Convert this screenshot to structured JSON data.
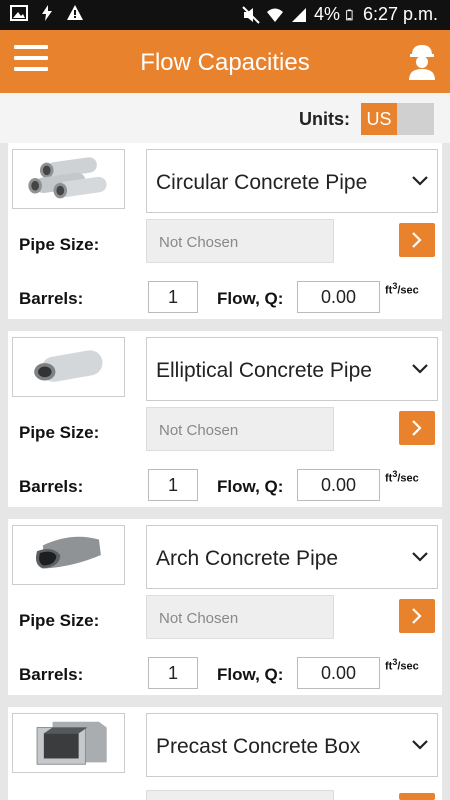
{
  "status": {
    "battery": "4%",
    "time": "6:27 p.m."
  },
  "app": {
    "title": "Flow Capacities"
  },
  "units": {
    "label": "Units:",
    "active": "US"
  },
  "labels": {
    "pipe_size": "Pipe Size:",
    "barrels": "Barrels:",
    "flow": "Flow, Q:",
    "flow_unit": "ft",
    "flow_unit_exp": "3",
    "flow_unit_tail": "/sec"
  },
  "cards": [
    {
      "type": "Circular Concrete Pipe",
      "pipe_size_placeholder": "Not Chosen",
      "barrels": "1",
      "flow": "0.00",
      "icon": "circular-pipe-icon"
    },
    {
      "type": "Elliptical Concrete Pipe",
      "pipe_size_placeholder": "Not Chosen",
      "barrels": "1",
      "flow": "0.00",
      "icon": "elliptical-pipe-icon"
    },
    {
      "type": "Arch Concrete Pipe",
      "pipe_size_placeholder": "Not Chosen",
      "barrels": "1",
      "flow": "0.00",
      "icon": "arch-pipe-icon"
    },
    {
      "type": "Precast Concrete Box",
      "icon": "box-culvert-icon"
    }
  ],
  "colors": {
    "accent": "#e8822c",
    "status_bar": "#111111",
    "background": "#e6e6e6"
  }
}
